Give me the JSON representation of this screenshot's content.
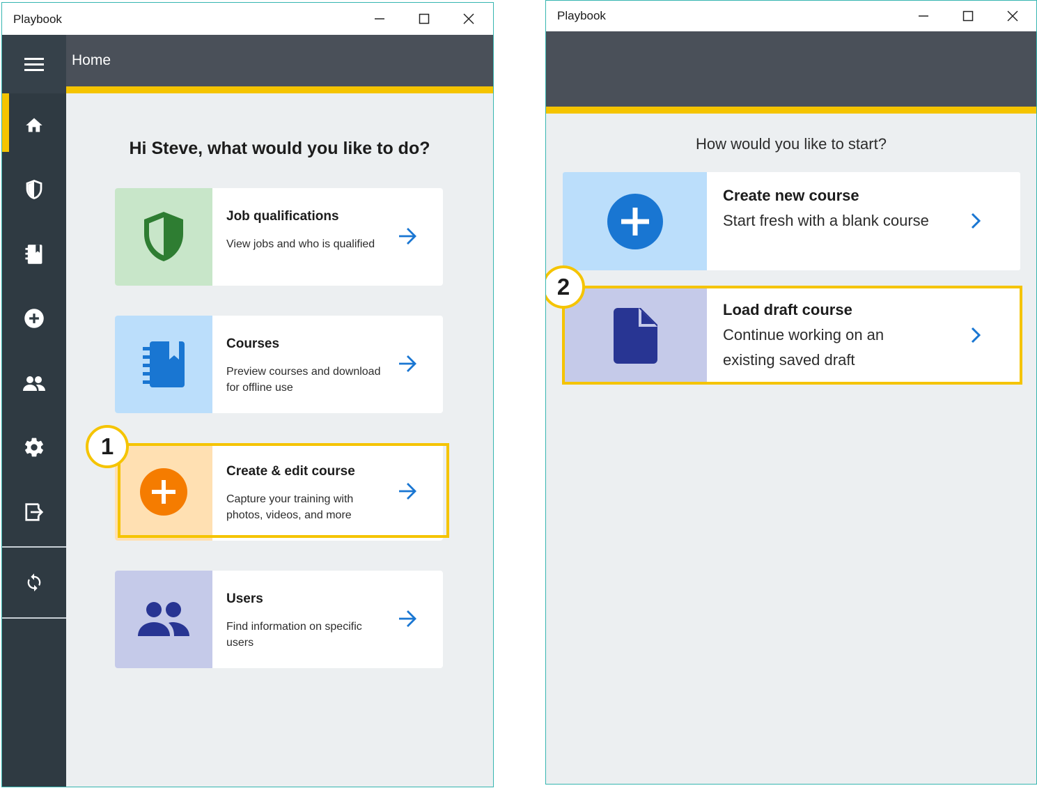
{
  "window1": {
    "title": "Playbook",
    "header_title": "Home",
    "greeting": "Hi Steve, what would you like to do?",
    "sidebar": [
      {
        "icon": "home-icon",
        "selected": true
      },
      {
        "icon": "shield-icon"
      },
      {
        "icon": "book-icon"
      },
      {
        "icon": "add-circle-icon"
      },
      {
        "icon": "users-icon"
      },
      {
        "icon": "gear-icon"
      },
      {
        "icon": "exit-icon"
      },
      {
        "icon": "sync-icon"
      }
    ],
    "cards": [
      {
        "title": "Job qualifications",
        "desc": "View jobs and who is qualified",
        "icon": "shield-icon",
        "color": "#c8e6c9"
      },
      {
        "title": "Courses",
        "desc": "Preview courses and download for offline use",
        "icon": "book-icon",
        "color": "#bbdefb"
      },
      {
        "title": "Create & edit course",
        "desc": "Capture your training with photos, videos, and more",
        "icon": "add-circle-icon",
        "color": "#ffe0b2"
      },
      {
        "title": "Users",
        "desc": "Find information on specific users",
        "icon": "users-icon",
        "color": "#c5cae9"
      }
    ],
    "callout": "1"
  },
  "window2": {
    "title": "Playbook",
    "heading": "How would you like to start?",
    "cards": [
      {
        "title": "Create new course",
        "desc": "Start fresh with a blank course",
        "icon": "add-circle-icon",
        "color": "#bbdefb"
      },
      {
        "title": "Load draft course",
        "desc": "Continue working on an existing saved draft",
        "icon": "document-icon",
        "color": "#c5cae9"
      }
    ],
    "callout": "2"
  },
  "colors": {
    "accent": "#f5c400",
    "appbar": "#4a5059",
    "sidebar": "#2f3a42",
    "link": "#1976d2"
  }
}
